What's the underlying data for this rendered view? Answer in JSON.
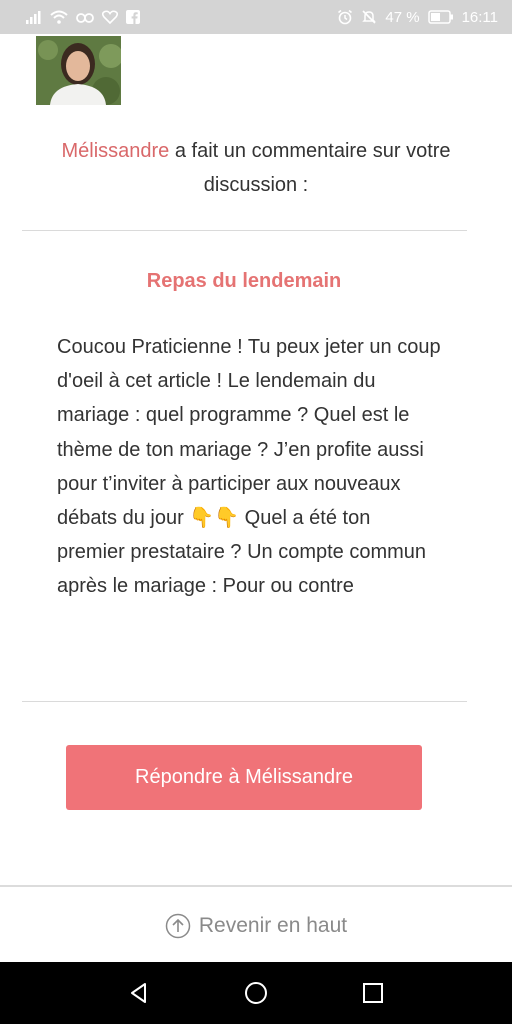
{
  "status_bar": {
    "battery_percent": "47 %",
    "time": "16:11",
    "icons_left": [
      "signal-icon",
      "wifi-icon",
      "data-icon",
      "heart-icon",
      "facebook-icon"
    ],
    "icons_right": [
      "alarm-icon",
      "mute-icon",
      "battery-icon"
    ]
  },
  "notification": {
    "author": "Mélissandre",
    "header_text": " a fait un commentaire sur votre discussion :",
    "discussion_title": "Repas du lendemain",
    "comment_body": "Coucou Praticienne ! Tu peux jeter un coup d'oeil à cet article ! Le lendemain du mariage : quel programme ? Quel est le thème de ton mariage ? J’en profite aussi pour t’inviter à participer aux nouveaux débats du jour 👇👇 Quel a été ton premier prestataire ? Un compte commun après le mariage : Pour ou contre",
    "reply_label": "Répondre à Mélissandre"
  },
  "footer": {
    "back_to_top_label": "Revenir en haut"
  },
  "nav_bar": {
    "buttons": [
      "back-icon",
      "home-icon",
      "recents-icon"
    ]
  },
  "colors": {
    "accent": "#e57373",
    "button": "#f07378",
    "status_bar": "#d4d4d4",
    "nav_bar": "#000000"
  }
}
